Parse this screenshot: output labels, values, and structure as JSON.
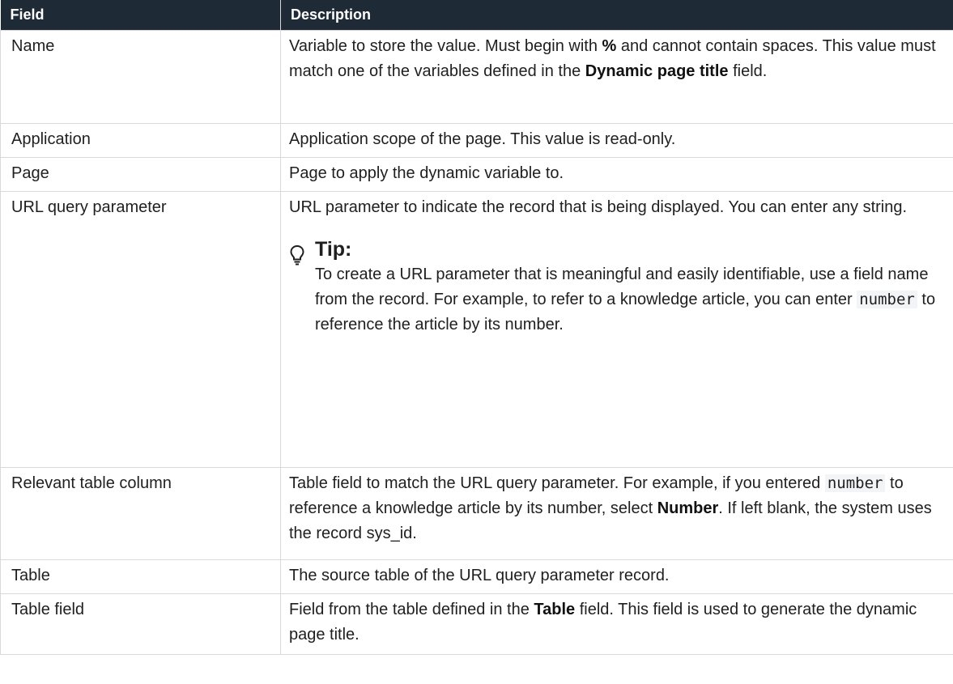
{
  "header": {
    "col1": "Field",
    "col2": "Description"
  },
  "rows": [
    {
      "field": "Name",
      "desc_p1": "Variable to store the value. Must begin with ",
      "desc_b1": "%",
      "desc_p2": " and cannot contain spaces. This value must match one of the variables defined in the ",
      "desc_b2": "Dynamic page title",
      "desc_p3": " field."
    },
    {
      "field": "Application",
      "desc": "Application scope of the page. This value is read-only."
    },
    {
      "field": "Page",
      "desc": "Page to apply the dynamic variable to."
    },
    {
      "field": "URL query parameter",
      "desc": "URL parameter to indicate the record that is being displayed. You can enter any string.",
      "tip": {
        "icon": "lightbulb-icon",
        "title": "Tip:",
        "text_p1": "To create a URL parameter that is meaningful and easily identifiable, use a field name from the record. For example, to refer to a knowledge article, you can enter ",
        "code": "number",
        "text_p2": " to reference the article by its number."
      }
    },
    {
      "field": "Relevant table column",
      "desc_p1": "Table field to match the URL query parameter. For example, if you entered ",
      "desc_code": "number",
      "desc_p2": " to reference a knowledge article by its number, select ",
      "desc_b1": "Number",
      "desc_p3": ". If left blank, the system uses the record sys_id."
    },
    {
      "field": "Table",
      "desc": "The source table of the URL query parameter record."
    },
    {
      "field": "Table field",
      "desc_p1": "Field from the table defined in the ",
      "desc_b1": "Table",
      "desc_p2": " field. This field is used to generate the dynamic page title."
    }
  ]
}
